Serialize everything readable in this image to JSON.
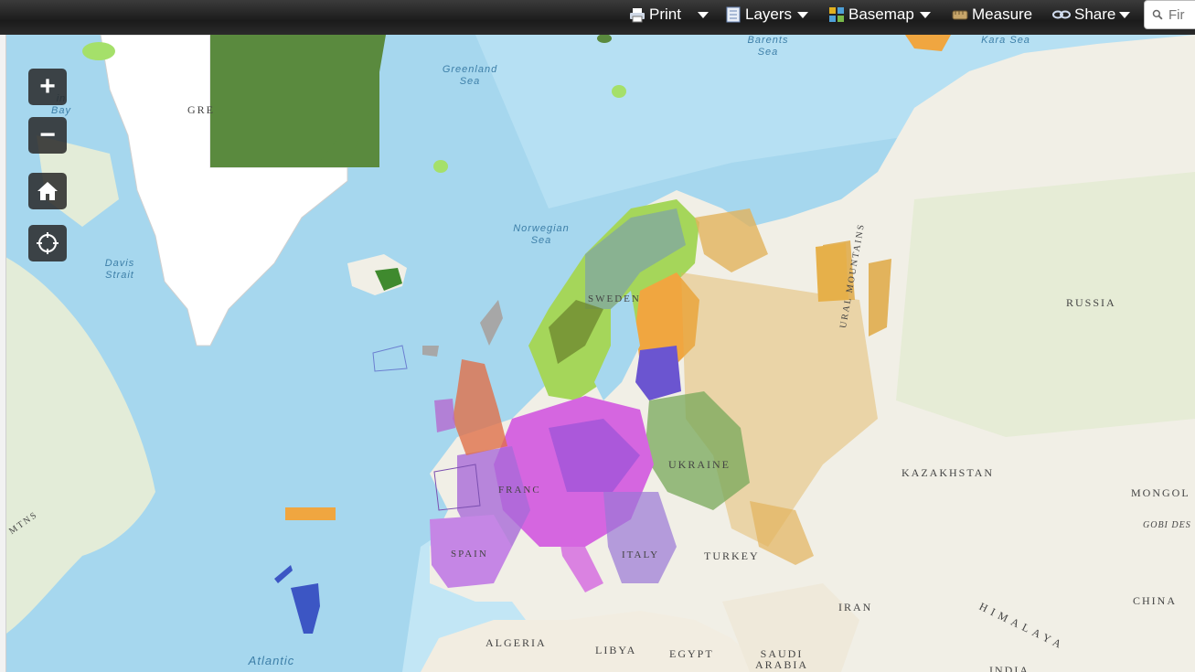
{
  "toolbar": {
    "print": "Print",
    "layers": "Layers",
    "basemap": "Basemap",
    "measure": "Measure",
    "share": "Share",
    "search_placeholder": "Fir"
  },
  "controls": {
    "zoom_in": "+",
    "zoom_out": "−"
  },
  "labels": {
    "russia": "RUSSIA",
    "kazakhstan": "KAZAKHSTAN",
    "mongolia": "MONGOL",
    "china": "CHINA",
    "turkey": "TURKEY",
    "iran": "IRAN",
    "algeria": "ALGERIA",
    "libya": "LIBYA",
    "egypt": "EGYPT",
    "saudi": "SAUDI ARABIA",
    "ukraine": "UKRAINE",
    "india": "INDIA",
    "greenland": "GRE",
    "ural": "URAL MOUNTAINS",
    "himalaya": "HIMALAYA",
    "gobi": "GOBI DES",
    "mtns": "MTNS",
    "france": "FRANC",
    "spain": "SPAIN",
    "italy": "ITALY",
    "sweden": "SWEDEN"
  },
  "seas": {
    "barents": "Barents Sea",
    "kara": "Kara Sea",
    "greenland_sea": "Greenland Sea",
    "norwegian": "Norwegian Sea",
    "davis": "Davis Strait",
    "atlantic": "Atlantic",
    "baffin": "in Bay"
  },
  "colors": {
    "toolbar_bg": "#222222",
    "ocean": "#a6d7ee",
    "land": "#f1efe6",
    "greenland": "#ffffff",
    "dark_green": "#5a8a3e",
    "orange": "#f0a640",
    "light_green": "#a5d65a",
    "magenta": "#d566e0",
    "purple": "#6b55d0",
    "gold": "#e2b35c",
    "grey": "#a7a7a7"
  }
}
